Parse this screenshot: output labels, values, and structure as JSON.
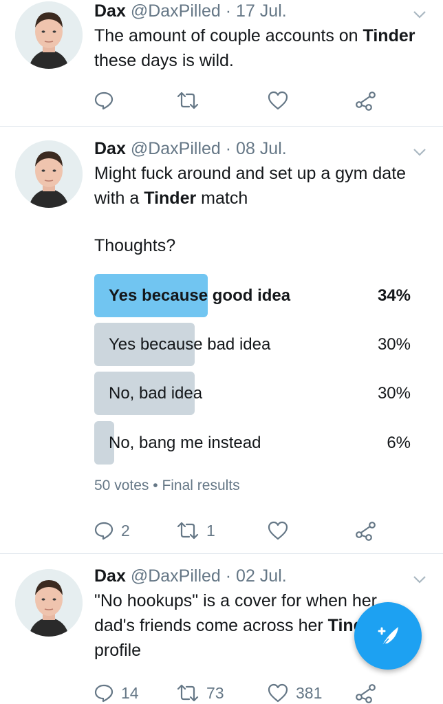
{
  "colors": {
    "accent": "#1da1f2",
    "poll_winner": "#71c5f1",
    "poll_bar": "#ccd6dd",
    "muted": "#657786",
    "divider": "#e1e8ed"
  },
  "tweets": [
    {
      "name": "Dax",
      "handle": "@DaxPilled",
      "sep": "·",
      "date": "17 Jul.",
      "text_before": "The amount of couple accounts on ",
      "text_bold": "Tinder",
      "text_after": " these days is wild.",
      "icons": [
        "reply-icon",
        "retweet-icon",
        "like-icon",
        "share-icon"
      ]
    },
    {
      "name": "Dax",
      "handle": "@DaxPilled",
      "sep": "·",
      "date": "08 Jul.",
      "text_before": "Might fuck around and set up a gym date with a ",
      "text_bold": "Tinder",
      "text_after": " match",
      "text_line2": "Thoughts?",
      "poll": {
        "options": [
          {
            "label": "Yes because good idea",
            "percent": "34%",
            "fraction": 0.34,
            "winner": true
          },
          {
            "label": "Yes because bad idea",
            "percent": "30%",
            "fraction": 0.3,
            "winner": false
          },
          {
            "label": "No, bad idea",
            "percent": "30%",
            "fraction": 0.3,
            "winner": false
          },
          {
            "label": "No, bang me instead",
            "percent": "6%",
            "fraction": 0.06,
            "winner": false
          }
        ],
        "votes": "50 votes",
        "dot": "•",
        "status": "Final results"
      },
      "replies": "2",
      "retweets": "1"
    },
    {
      "name": "Dax",
      "handle": "@DaxPilled",
      "sep": "·",
      "date": "02 Jul.",
      "text_before": "\"No hookups\" is a cover for when her dad's friends come across her ",
      "text_bold": "Tinder",
      "text_after": " profile",
      "replies": "14",
      "retweets": "73",
      "likes": "381"
    }
  ],
  "fab": {
    "icon": "compose-tweet-icon"
  }
}
